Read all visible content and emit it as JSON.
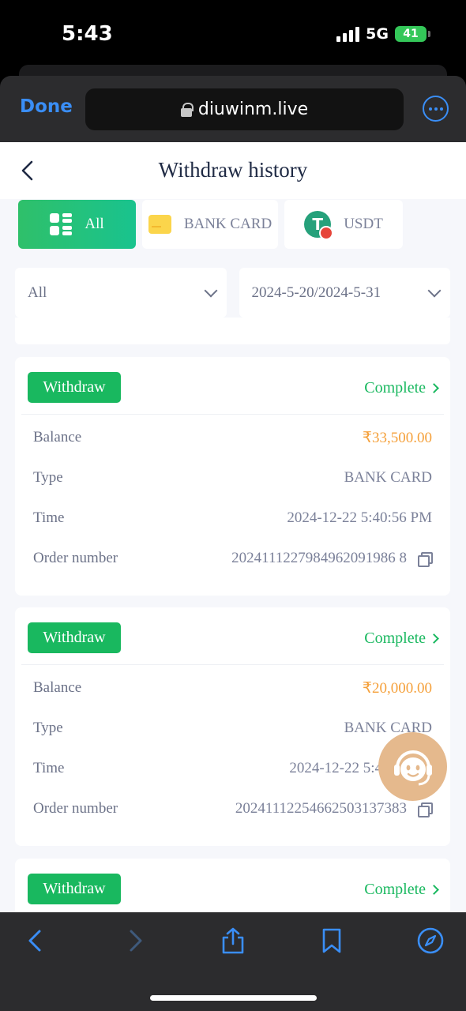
{
  "status_bar": {
    "time": "5:43",
    "network": "5G",
    "battery": "41"
  },
  "browser": {
    "done_label": "Done",
    "url": "diuwinm.live"
  },
  "header": {
    "title": "Withdraw history"
  },
  "tabs": [
    {
      "label": "All",
      "icon": "grid-icon",
      "active": true
    },
    {
      "label": "BANK CARD",
      "icon": "bank-card-icon",
      "active": false
    },
    {
      "label": "USDT",
      "icon": "usdt-icon",
      "active": false
    }
  ],
  "filters": {
    "status": "All",
    "date_range": "2024-5-20/2024-5-31"
  },
  "row_labels": {
    "balance": "Balance",
    "type": "Type",
    "time": "Time",
    "order": "Order number"
  },
  "records": [
    {
      "badge": "Withdraw",
      "status": "Complete",
      "balance": "₹33,500.00",
      "type": "BANK CARD",
      "time": "2024-12-22 5:40:56 PM",
      "order": "2024111227984962091986 8"
    },
    {
      "badge": "Withdraw",
      "status": "Complete",
      "balance": "₹20,000.00",
      "type": "BANK CARD",
      "time": "2024-12-22 5:4",
      "order": "20241112254662503137383"
    },
    {
      "badge": "Withdraw",
      "status": "Complete"
    }
  ],
  "colors": {
    "accent_green": "#19b85f",
    "amount_orange": "#f5a03a",
    "ios_blue": "#3a8ef6"
  }
}
